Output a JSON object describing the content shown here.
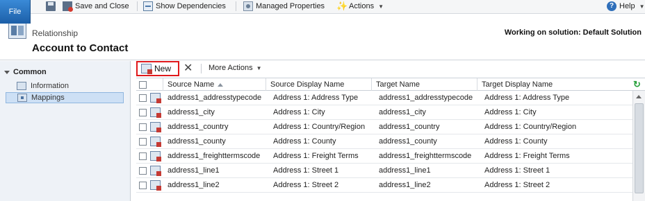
{
  "ribbon": {
    "file": "File",
    "save_close": "Save and Close",
    "show_dependencies": "Show Dependencies",
    "managed_properties": "Managed Properties",
    "actions": "Actions",
    "help": "Help"
  },
  "header": {
    "subtitle": "Relationship",
    "title": "Account to Contact",
    "solution": "Working on solution: Default Solution"
  },
  "nav": {
    "group": "Common",
    "items": [
      {
        "label": "Information"
      },
      {
        "label": "Mappings"
      }
    ]
  },
  "grid_toolbar": {
    "new": "New",
    "more_actions": "More Actions"
  },
  "columns": [
    "Source Name",
    "Source Display Name",
    "Target Name",
    "Target Display Name"
  ],
  "rows": [
    {
      "source": "address1_addresstypecode",
      "source_display": "Address 1: Address Type",
      "target": "address1_addresstypecode",
      "target_display": "Address 1: Address Type"
    },
    {
      "source": "address1_city",
      "source_display": "Address 1: City",
      "target": "address1_city",
      "target_display": "Address 1: City"
    },
    {
      "source": "address1_country",
      "source_display": "Address 1: Country/Region",
      "target": "address1_country",
      "target_display": "Address 1: Country/Region"
    },
    {
      "source": "address1_county",
      "source_display": "Address 1: County",
      "target": "address1_county",
      "target_display": "Address 1: County"
    },
    {
      "source": "address1_freighttermscode",
      "source_display": "Address 1: Freight Terms",
      "target": "address1_freighttermscode",
      "target_display": "Address 1: Freight Terms"
    },
    {
      "source": "address1_line1",
      "source_display": "Address 1: Street 1",
      "target": "address1_line1",
      "target_display": "Address 1: Street 1"
    },
    {
      "source": "address1_line2",
      "source_display": "Address 1: Street 2",
      "target": "address1_line2",
      "target_display": "Address 1: Street 2"
    }
  ]
}
